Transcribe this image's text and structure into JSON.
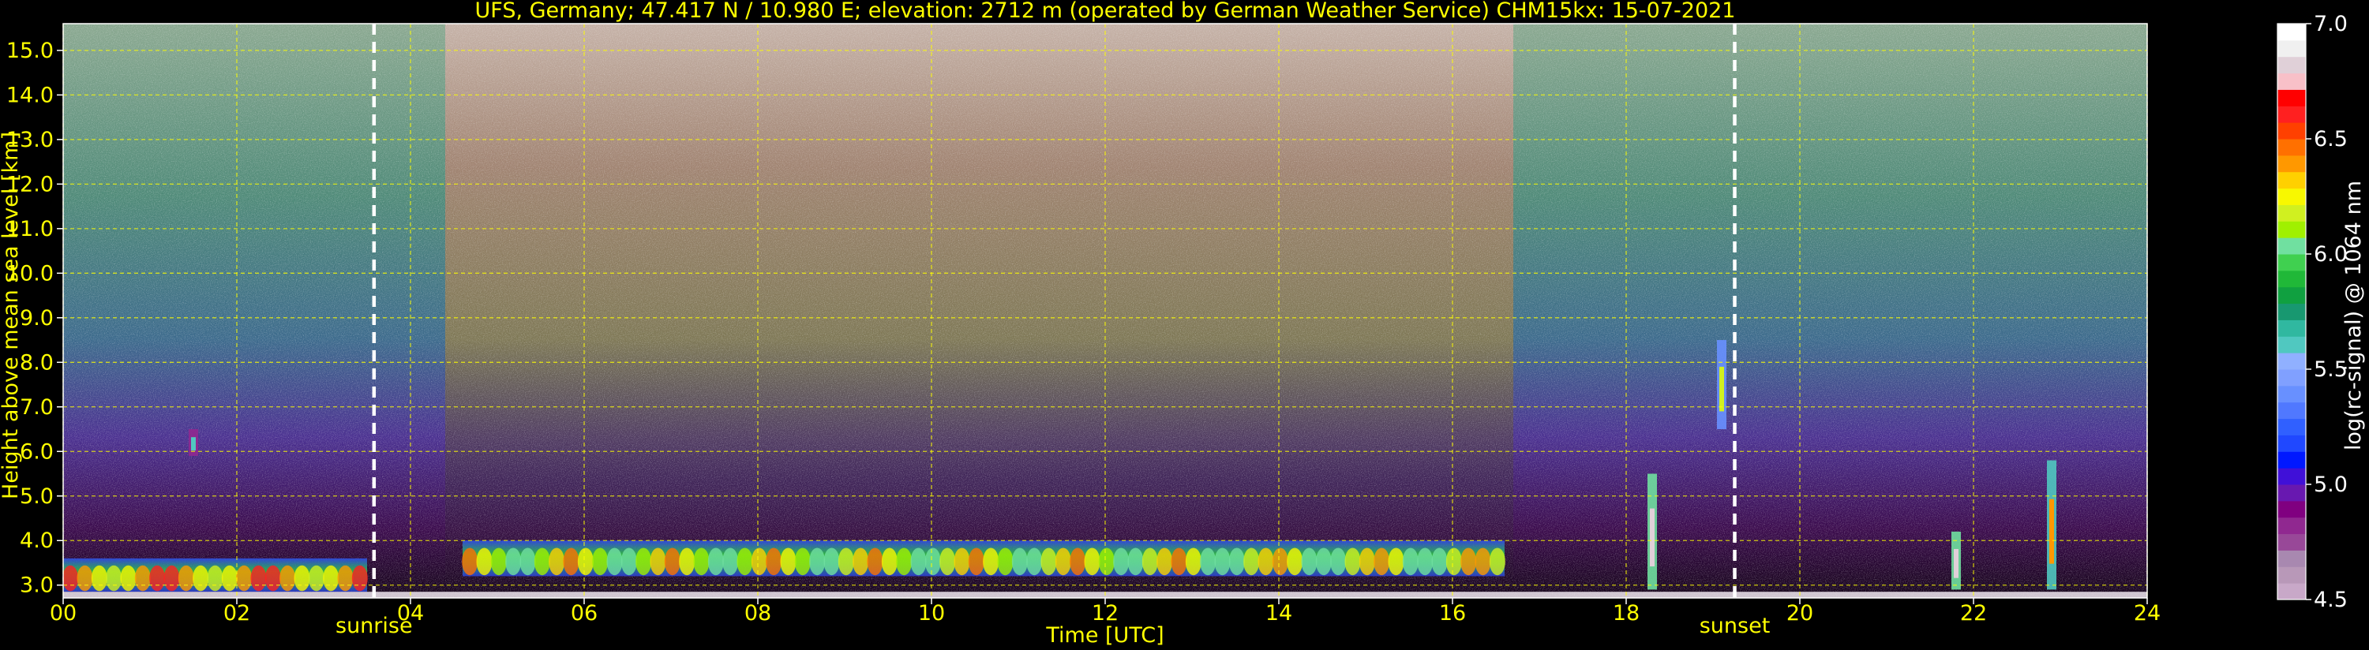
{
  "chart_data": {
    "type": "heatmap",
    "title": "UFS, Germany; 47.417 N / 10.980 E; elevation: 2712 m  (operated by German Weather Service)    CHM15kx: 15-07-2021",
    "xlabel": "Time [UTC]",
    "ylabel": "Height above mean sea level [km]",
    "xlim": [
      0,
      24
    ],
    "ylim": [
      2.712,
      15.6
    ],
    "x_ticks": [
      "00",
      "02",
      "04",
      "06",
      "08",
      "10",
      "12",
      "14",
      "16",
      "18",
      "20",
      "22",
      "24"
    ],
    "y_ticks": [
      "3.0",
      "4.0",
      "5.0",
      "6.0",
      "7.0",
      "8.0",
      "9.0",
      "10.0",
      "11.0",
      "12.0",
      "13.0",
      "14.0",
      "15.0"
    ],
    "grid": true,
    "annotations": [
      {
        "label": "sunrise",
        "x": 3.58
      },
      {
        "label": "sunset",
        "x": 19.25
      }
    ],
    "colorbar": {
      "label": "log(rc-signal) @ 1064 nm",
      "range": [
        4.5,
        7.0
      ],
      "ticks": [
        "4.5",
        "5.0",
        "5.5",
        "6.0",
        "6.5",
        "7.0"
      ],
      "colors": [
        "#c8a8c8",
        "#b898b8",
        "#a888b0",
        "#984898",
        "#902890",
        "#800080",
        "#6818b0",
        "#4010d8",
        "#0018ff",
        "#2048ff",
        "#3060ff",
        "#5078ff",
        "#6890ff",
        "#80a0ff",
        "#90b0ff",
        "#50c8c0",
        "#30b8a0",
        "#189870",
        "#10a040",
        "#20b838",
        "#40d050",
        "#70e0a0",
        "#a0f000",
        "#d0f020",
        "#f8f800",
        "#ffd000",
        "#ff9800",
        "#ff7000",
        "#ff4000",
        "#ff2020",
        "#ff0000",
        "#f8c0c8",
        "#e0d0d8",
        "#f0f0f0",
        "#ffffff"
      ]
    },
    "signal_features": [
      {
        "kind": "aerosol_layer",
        "t_start": 4.6,
        "t_end": 16.6,
        "h_bottom": 3.2,
        "h_top": 4.0,
        "peak_log_signal": 6.5
      },
      {
        "kind": "aerosol_layer",
        "t_start": 0.0,
        "t_end": 3.5,
        "h_bottom": 2.85,
        "h_top": 3.6,
        "peak_log_signal": 6.7
      },
      {
        "kind": "cloud",
        "t": 1.5,
        "h_bottom": 5.9,
        "h_top": 6.5,
        "peak_log_signal": 5.6
      },
      {
        "kind": "cloud",
        "t": 18.3,
        "h_bottom": 2.9,
        "h_top": 5.5,
        "peak_log_signal": 6.8
      },
      {
        "kind": "cloud",
        "t": 19.1,
        "h_bottom": 6.5,
        "h_top": 8.5,
        "peak_log_signal": 6.2
      },
      {
        "kind": "cloud",
        "t": 21.8,
        "h_bottom": 2.9,
        "h_top": 4.2,
        "peak_log_signal": 6.8
      },
      {
        "kind": "cloud",
        "t": 22.9,
        "h_bottom": 2.9,
        "h_top": 5.8,
        "peak_log_signal": 6.4
      }
    ]
  }
}
